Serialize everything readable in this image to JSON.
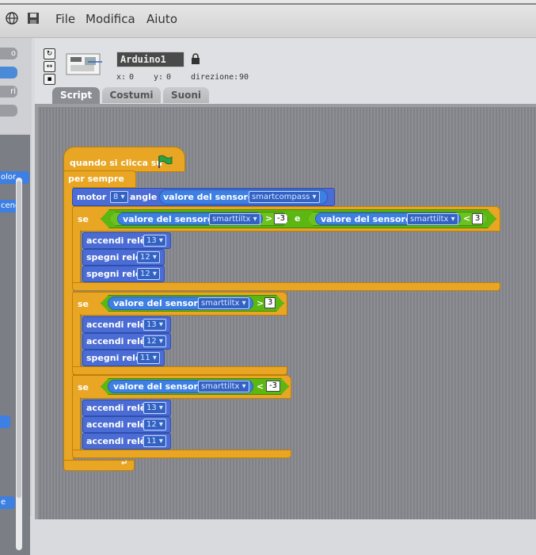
{
  "menu": {
    "file": "File",
    "edit": "Modifica",
    "help": "Aiuto"
  },
  "palette": {
    "buttons": [
      "o",
      "",
      "ri",
      ""
    ],
    "block_labels": [
      "olor",
      "ceno",
      "",
      "e"
    ]
  },
  "sprite": {
    "name": "Arduino1",
    "x_label": "x:",
    "x_value": "0",
    "y_label": "y:",
    "y_value": "0",
    "direction_label": "direzione:",
    "direction_value": "90"
  },
  "tabs": [
    "Script",
    "Costumi",
    "Suoni"
  ],
  "script": {
    "hat": "quando si clicca su",
    "forever": "per sempre",
    "motor": {
      "label": "motor",
      "port": "8",
      "angle_label": "angle",
      "sensor_label": "valore del sensore",
      "sensor": "smartcompass"
    },
    "if1": {
      "label": "se",
      "left": {
        "sensor_label": "valore del sensore",
        "sensor": "smarttiltx",
        "op": ">",
        "value": "-3"
      },
      "and": "e",
      "right": {
        "sensor_label": "valore del sensore",
        "sensor": "smarttiltx",
        "op": "<",
        "value": "3"
      },
      "actions": [
        {
          "label": "accendi relè",
          "pin": "13"
        },
        {
          "label": "spegni relè",
          "pin": "12"
        },
        {
          "label": "spegni relè",
          "pin": "12"
        }
      ]
    },
    "if2": {
      "label": "se",
      "cond": {
        "sensor_label": "valore del sensore",
        "sensor": "smarttiltx",
        "op": ">",
        "value": "3"
      },
      "actions": [
        {
          "label": "accendi relè",
          "pin": "13"
        },
        {
          "label": "accendi relè",
          "pin": "12"
        },
        {
          "label": "spegni relè",
          "pin": "11"
        }
      ]
    },
    "if3": {
      "label": "se",
      "cond": {
        "sensor_label": "valore del sensore",
        "sensor": "smarttiltx",
        "op": "<",
        "value": "-3"
      },
      "actions": [
        {
          "label": "accendi relè",
          "pin": "13"
        },
        {
          "label": "accendi relè",
          "pin": "12"
        },
        {
          "label": "accendi relè",
          "pin": "11"
        }
      ]
    }
  },
  "colors": {
    "control": "#e8a624",
    "motion": "#4a6cd4",
    "sensing": "#3d7fe2",
    "operators": "#5cb712",
    "flag": "#2ea043"
  }
}
